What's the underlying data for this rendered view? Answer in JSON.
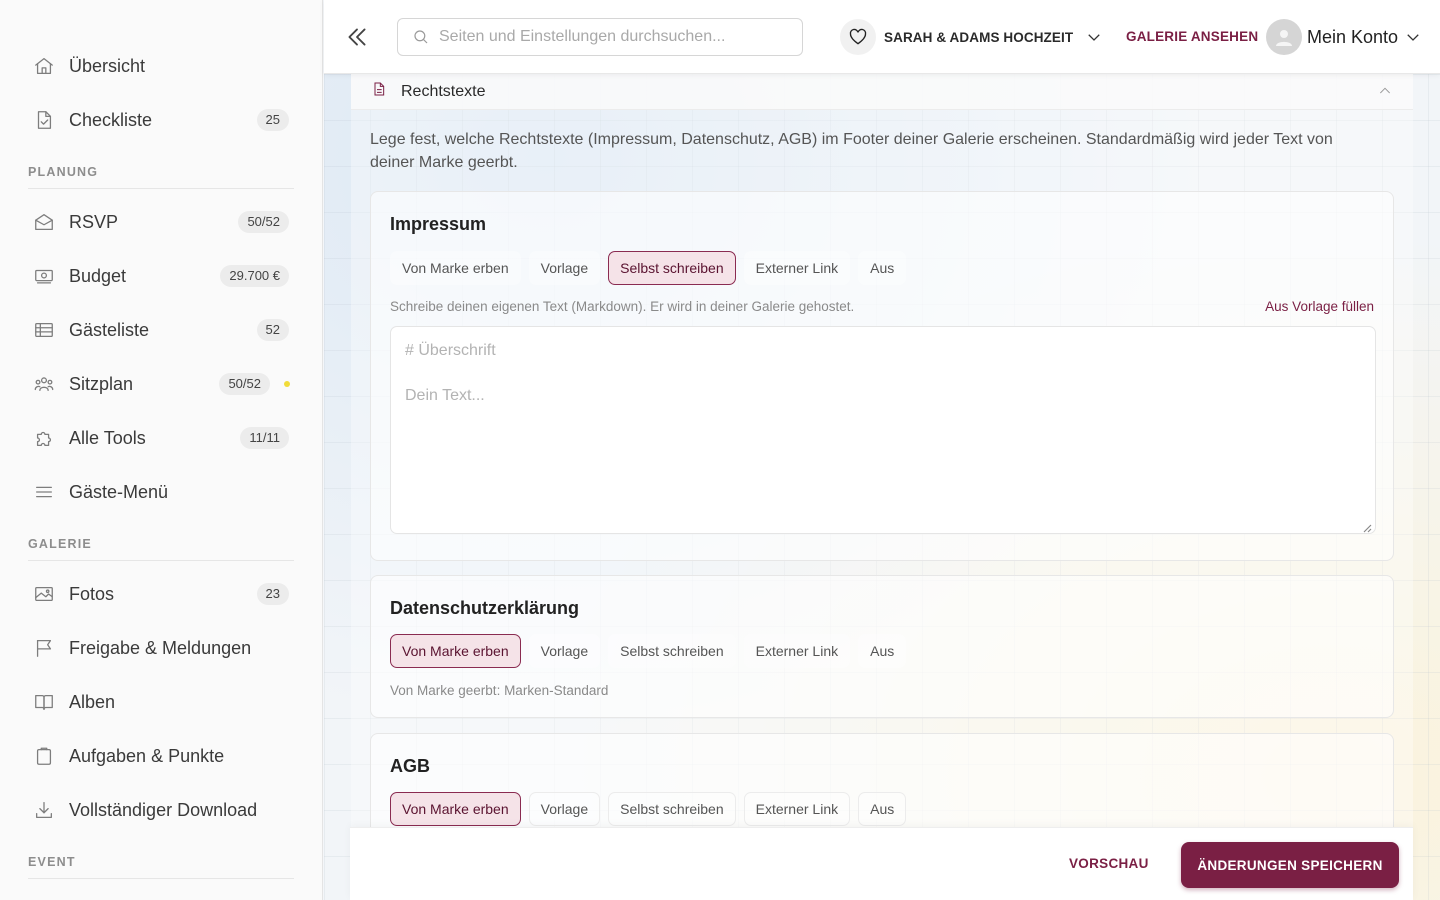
{
  "sidebar": {
    "items_top": [
      {
        "label": "Übersicht",
        "icon": "home-icon"
      },
      {
        "label": "Checkliste",
        "icon": "checklist-icon",
        "badge": "25"
      }
    ],
    "sections": [
      {
        "title": "PLANUNG",
        "items": [
          {
            "label": "RSVP",
            "icon": "envelope-icon",
            "badge": "50/52"
          },
          {
            "label": "Budget",
            "icon": "money-icon",
            "badge": "29.700 €"
          },
          {
            "label": "Gästeliste",
            "icon": "table-icon",
            "badge": "52"
          },
          {
            "label": "Sitzplan",
            "icon": "people-icon",
            "badge": "50/52",
            "dot": true,
            "dot_color": "#f1dc3a"
          },
          {
            "label": "Alle Tools",
            "icon": "puzzle-icon",
            "badge": "11/11"
          },
          {
            "label": "Gäste-Menü",
            "icon": "menu-icon"
          }
        ]
      },
      {
        "title": "GALERIE",
        "items": [
          {
            "label": "Fotos",
            "icon": "image-icon",
            "badge": "23"
          },
          {
            "label": "Freigabe & Meldungen",
            "icon": "flag-icon"
          },
          {
            "label": "Alben",
            "icon": "book-icon"
          },
          {
            "label": "Aufgaben & Punkte",
            "icon": "clipboard-icon"
          },
          {
            "label": "Vollständiger Download",
            "icon": "download-icon"
          }
        ]
      },
      {
        "title": "EVENT",
        "items": []
      }
    ]
  },
  "topbar": {
    "search_placeholder": "Seiten und Einstellungen durchsuchen...",
    "event_name": "SARAH & ADAMS HOCHZEIT",
    "gallery_link": "GALERIE ANSEHEN",
    "account_label": "Mein Konto"
  },
  "panel": {
    "title": "Rechtstexte",
    "intro": "Lege fest, welche Rechtstexte (Impressum, Datenschutz, AGB) im Footer deiner Galerie erscheinen. Standardmäßig wird jeder Text von deiner Marke geerbt."
  },
  "options": [
    "Von Marke erben",
    "Vorlage",
    "Selbst schreiben",
    "Externer Link",
    "Aus"
  ],
  "impressum": {
    "title": "Impressum",
    "selected": "Selbst schreiben",
    "hint": "Schreibe deinen eigenen Text (Markdown). Er wird in deiner Galerie gehostet.",
    "fill_link": "Aus Vorlage füllen",
    "heading_placeholder": "# Überschrift",
    "text_placeholder": "Dein Text..."
  },
  "datenschutz": {
    "title": "Datenschutzerklärung",
    "selected": "Von Marke erben",
    "hint": "Von Marke geerbt: Marken-Standard"
  },
  "agb": {
    "title": "AGB",
    "selected": "Von Marke erben"
  },
  "actions": {
    "preview": "VORSCHAU",
    "save": "ÄNDERUNGEN SPEICHERN"
  },
  "colors": {
    "accent": "#7a1f44",
    "accent_light": "#f5e3e8",
    "notification_dot": "#f1dc3a"
  }
}
